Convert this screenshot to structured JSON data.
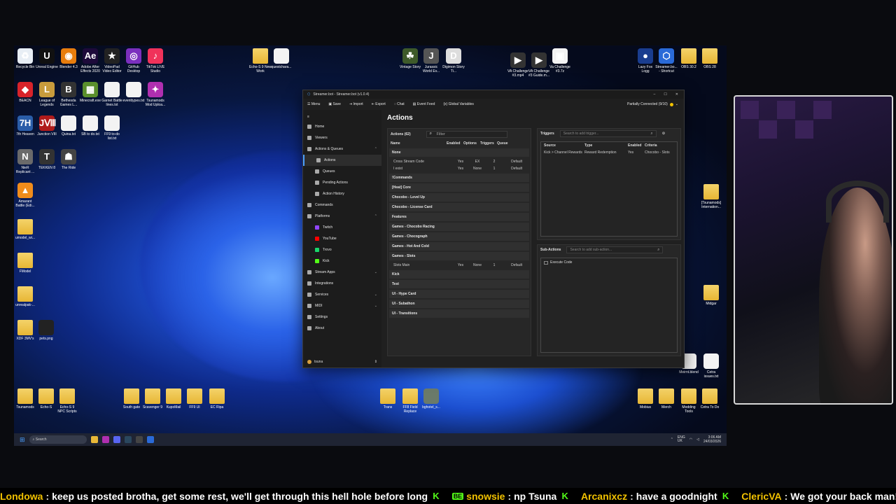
{
  "desktop": {
    "icons_top_left": [
      {
        "label": "Recycle Bin",
        "glyph": "♻",
        "color": "#e8eef5"
      },
      {
        "label": "Unreal Engine",
        "glyph": "U",
        "color": "#111"
      },
      {
        "label": "Blender 4.3",
        "glyph": "◉",
        "color": "#e87d0d"
      },
      {
        "label": "Adobe After Effects 2020",
        "glyph": "Ae",
        "color": "#1d0a3a"
      },
      {
        "label": "VideoPad Video Editor",
        "glyph": "★",
        "color": "#222"
      },
      {
        "label": "GitHub Desktop",
        "glyph": "◎",
        "color": "#7b2fbe"
      },
      {
        "label": "TikTok LIVE Studio",
        "glyph": "♪",
        "color": "#f0325a"
      }
    ],
    "icons_row2": [
      {
        "label": "BEACN",
        "glyph": "◆",
        "color": "#d8232a"
      },
      {
        "label": "League of Legends",
        "glyph": "L",
        "color": "#c89b3c"
      },
      {
        "label": "Bethesda Games L...",
        "glyph": "B",
        "color": "#333"
      },
      {
        "label": "Minecraft.exe",
        "glyph": "▦",
        "color": "#5a8f2c"
      },
      {
        "label": "Garnet Battle lines.txt",
        "glyph": "",
        "color": "#f3f3f3"
      },
      {
        "label": "eventtypes.txt",
        "glyph": "",
        "color": "#f3f3f3"
      },
      {
        "label": "Tsunamods Mod Uploa...",
        "glyph": "✦",
        "color": "#b02fb0"
      }
    ],
    "icons_row3": [
      {
        "label": "7th Heaven",
        "glyph": "7H",
        "color": "#2a5da8"
      },
      {
        "label": "Junction VIII",
        "glyph": "JⅧ",
        "color": "#b01b1b"
      },
      {
        "label": "Quina.txt",
        "glyph": "",
        "color": "#f3f3f3"
      },
      {
        "label": "SB to do.txt",
        "glyph": "",
        "color": "#f3f3f3"
      },
      {
        "label": "FF9 to-do list.txt",
        "glyph": "",
        "color": "#f3f3f3"
      }
    ],
    "icons_row4": [
      {
        "label": "NieR Replicant ...",
        "glyph": "N",
        "color": "#6a6a6a"
      },
      {
        "label": "TEKKEN 8",
        "glyph": "T",
        "color": "#333"
      },
      {
        "label": "The Ride",
        "glyph": "☗",
        "color": "#444"
      }
    ],
    "icons_left_column": [
      {
        "label": "Amarant Battle (Edi...",
        "glyph": "▲",
        "color": "#f08c1b"
      },
      {
        "label": "umodel_wi...",
        "glyph": "",
        "color": "folder"
      },
      {
        "label": "FModel",
        "glyph": "",
        "color": "folder"
      },
      {
        "label": "unrealpak-...",
        "glyph": "",
        "color": "folder"
      },
      {
        "label": "XDF 3MV's",
        "glyph": "",
        "color": "folder"
      },
      {
        "label": "pets.png",
        "glyph": "",
        "color": "#222"
      }
    ],
    "icons_top_center": [
      {
        "label": "Echo-S 9 New Work",
        "glyph": "",
        "color": "folder"
      },
      {
        "label": "questchara...",
        "glyph": "",
        "color": "#f3f3f3"
      }
    ],
    "icons_top_mid": [
      {
        "label": "Vintage Story",
        "glyph": "☘",
        "color": "#3e5a2a"
      },
      {
        "label": "Jurassic World Ev...",
        "glyph": "J",
        "color": "#555"
      },
      {
        "label": "Digimon Story Ti...",
        "glyph": "D",
        "color": "#ddd"
      }
    ],
    "icons_top_right_mid": [
      {
        "label": "VA Challenge #3.mp4",
        "glyph": "▶",
        "color": "#333"
      },
      {
        "label": "VA Challenge #3 Guide.m...",
        "glyph": "▶",
        "color": "#333"
      },
      {
        "label": "Va Challenge #3.7z",
        "glyph": "▣",
        "color": "#f3f3f3"
      }
    ],
    "icons_top_right": [
      {
        "label": "Lazy Fox Logg",
        "glyph": "●",
        "color": "#1a3d8f"
      },
      {
        "label": "Streamer.bo... - Shortcut",
        "glyph": "⬡",
        "color": "#2a6ad8"
      },
      {
        "label": "OBS 30.2",
        "glyph": "",
        "color": "folder"
      },
      {
        "label": "OBS 28",
        "glyph": "",
        "color": "folder"
      }
    ],
    "icons_right_column": [
      {
        "label": "[Tsunamods] Internation...",
        "glyph": "",
        "color": "folder"
      },
      {
        "label": "Midgar",
        "glyph": "",
        "color": "folder"
      },
      {
        "label": "Meirnt.blend",
        "glyph": "",
        "color": "#f3f3f3"
      },
      {
        "label": "Cetra issues.txt",
        "glyph": "",
        "color": "#f3f3f3"
      }
    ],
    "icons_bottom_left": [
      {
        "label": "Tsunamods",
        "glyph": "",
        "color": "folder"
      },
      {
        "label": "Echo-S",
        "glyph": "",
        "color": "folder"
      },
      {
        "label": "Echo-S 9 NPC Scripts",
        "glyph": "",
        "color": "folder"
      }
    ],
    "icons_bottom_center": [
      {
        "label": "South gate",
        "glyph": "",
        "color": "folder"
      },
      {
        "label": "Scavenger 9",
        "glyph": "",
        "color": "folder"
      },
      {
        "label": "KupoMail",
        "glyph": "",
        "color": "folder"
      },
      {
        "label": "FF9 UI",
        "glyph": "",
        "color": "folder"
      },
      {
        "label": "EC Ripa",
        "glyph": "",
        "color": "folder"
      }
    ],
    "icons_bottom_mid": [
      {
        "label": "Trans",
        "glyph": "",
        "color": "folder"
      },
      {
        "label": "FF8 Field Replace",
        "glyph": "",
        "color": "folder"
      },
      {
        "label": "bghotel_s...",
        "glyph": "",
        "color": "#6a7a6a"
      }
    ],
    "icons_bottom_right": [
      {
        "label": "Mobius",
        "glyph": "",
        "color": "folder"
      },
      {
        "label": "Merch",
        "glyph": "",
        "color": "folder"
      },
      {
        "label": "Modding Tools",
        "glyph": "",
        "color": "folder"
      },
      {
        "label": "Cetra To Do",
        "glyph": "",
        "color": "folder"
      }
    ]
  },
  "taskbar": {
    "search_placeholder": "Search",
    "lang": "ENG\nUK",
    "time": "3:06 AM",
    "date": "24/03/2026"
  },
  "streamerbot": {
    "window_title": "Streamer.bot - Streamer.bot (v1.0.4)",
    "menu": [
      "Menu",
      "Save",
      "Import",
      "Export",
      "Chat",
      "Event Feed",
      "Global Variables"
    ],
    "connection_status": "Partially Connected (9/10)",
    "nav": [
      {
        "label": "Home",
        "sub": false,
        "color": "#aaa"
      },
      {
        "label": "Viewers",
        "sub": false,
        "color": "#aaa"
      },
      {
        "label": "Actions & Queues",
        "sub": false,
        "chev": "⌃",
        "color": "#aaa"
      },
      {
        "label": "Actions",
        "sub": true,
        "active": true,
        "color": "#aaa"
      },
      {
        "label": "Queues",
        "sub": true,
        "color": "#aaa"
      },
      {
        "label": "Pending Actions",
        "sub": true,
        "color": "#aaa"
      },
      {
        "label": "Action History",
        "sub": true,
        "color": "#aaa"
      },
      {
        "label": "Commands",
        "sub": false,
        "color": "#aaa"
      },
      {
        "label": "Platforms",
        "sub": false,
        "chev": "⌃",
        "color": "#aaa"
      },
      {
        "label": "Twitch",
        "sub": true,
        "color": "#9146ff"
      },
      {
        "label": "YouTube",
        "sub": true,
        "color": "#ff0000"
      },
      {
        "label": "Trovo",
        "sub": true,
        "color": "#19d66b"
      },
      {
        "label": "Kick",
        "sub": true,
        "color": "#53fc18"
      },
      {
        "label": "Stream Apps",
        "sub": false,
        "chev": "⌄",
        "color": "#aaa"
      },
      {
        "label": "Integrations",
        "sub": false,
        "color": "#aaa"
      },
      {
        "label": "Services",
        "sub": false,
        "chev": "⌄",
        "color": "#aaa"
      },
      {
        "label": "MIDI",
        "sub": false,
        "chev": "⌄",
        "color": "#aaa"
      },
      {
        "label": "Settings",
        "sub": false,
        "color": "#aaa"
      },
      {
        "label": "About",
        "sub": false,
        "color": "#aaa"
      }
    ],
    "user": "tsuna",
    "page_title": "Actions",
    "actions_panel": {
      "title": "Actions (62)",
      "filter_placeholder": "Filter",
      "columns": [
        "Name",
        "Enabled",
        "Options",
        "Triggers",
        "Queue"
      ],
      "groups": [
        {
          "name": "None",
          "count": "",
          "rows": [
            [
              "Cross Stream Code",
              "Yes",
              "EX",
              "2",
              "Default"
            ],
            [
              "I exist",
              "Yes",
              "None",
              "1",
              "Default"
            ]
          ]
        },
        {
          "name": "!Commands",
          "count": "",
          "rows": []
        },
        {
          "name": "[Heat] Core",
          "count": "",
          "rows": []
        },
        {
          "name": "Chocobo - Level Up",
          "count": "",
          "rows": []
        },
        {
          "name": "Chocobo - License Card",
          "count": "",
          "rows": []
        },
        {
          "name": "Features",
          "count": "",
          "rows": []
        },
        {
          "name": "Games - Chocobo Racing",
          "count": "",
          "rows": []
        },
        {
          "name": "Games - Chocograph",
          "count": "",
          "rows": []
        },
        {
          "name": "Games - Hot And Cold",
          "count": "",
          "rows": []
        },
        {
          "name": "Games - Slots",
          "count": "",
          "rows": [
            [
              "Slots Main",
              "Yes",
              "None",
              "1",
              "Default"
            ]
          ]
        },
        {
          "name": "Kick",
          "count": "",
          "rows": []
        },
        {
          "name": "Test",
          "count": "",
          "rows": []
        },
        {
          "name": "UI - Hype Card",
          "count": "",
          "rows": []
        },
        {
          "name": "UI - Subathon",
          "count": "",
          "rows": []
        },
        {
          "name": "UI - Transitions",
          "count": "",
          "rows": []
        }
      ]
    },
    "triggers_panel": {
      "title": "Triggers",
      "search_placeholder": "Search to add trigger...",
      "columns": [
        "Source",
        "Type",
        "Enabled",
        "Criteria"
      ],
      "rows": [
        [
          "Kick > Channel Rewards",
          "Reward Redemption",
          "Yes",
          "Chocobo - Slots"
        ]
      ]
    },
    "subactions_panel": {
      "title": "Sub-Actions",
      "search_placeholder": "Search to add sub-action...",
      "items": [
        "Execute Code"
      ]
    }
  },
  "chat_ticker": [
    {
      "user": "Londowa",
      "msg": "keep us posted brotha, get some rest, we'll get through this hell hole before long",
      "badge": ""
    },
    {
      "user": "snowsie",
      "msg": "np Tsuna",
      "badge": "BE"
    },
    {
      "user": "Arcanixcz",
      "msg": "have a goodnight",
      "badge": ""
    },
    {
      "user": "ClericVA",
      "msg": "We got your back man!",
      "badge": ""
    }
  ]
}
